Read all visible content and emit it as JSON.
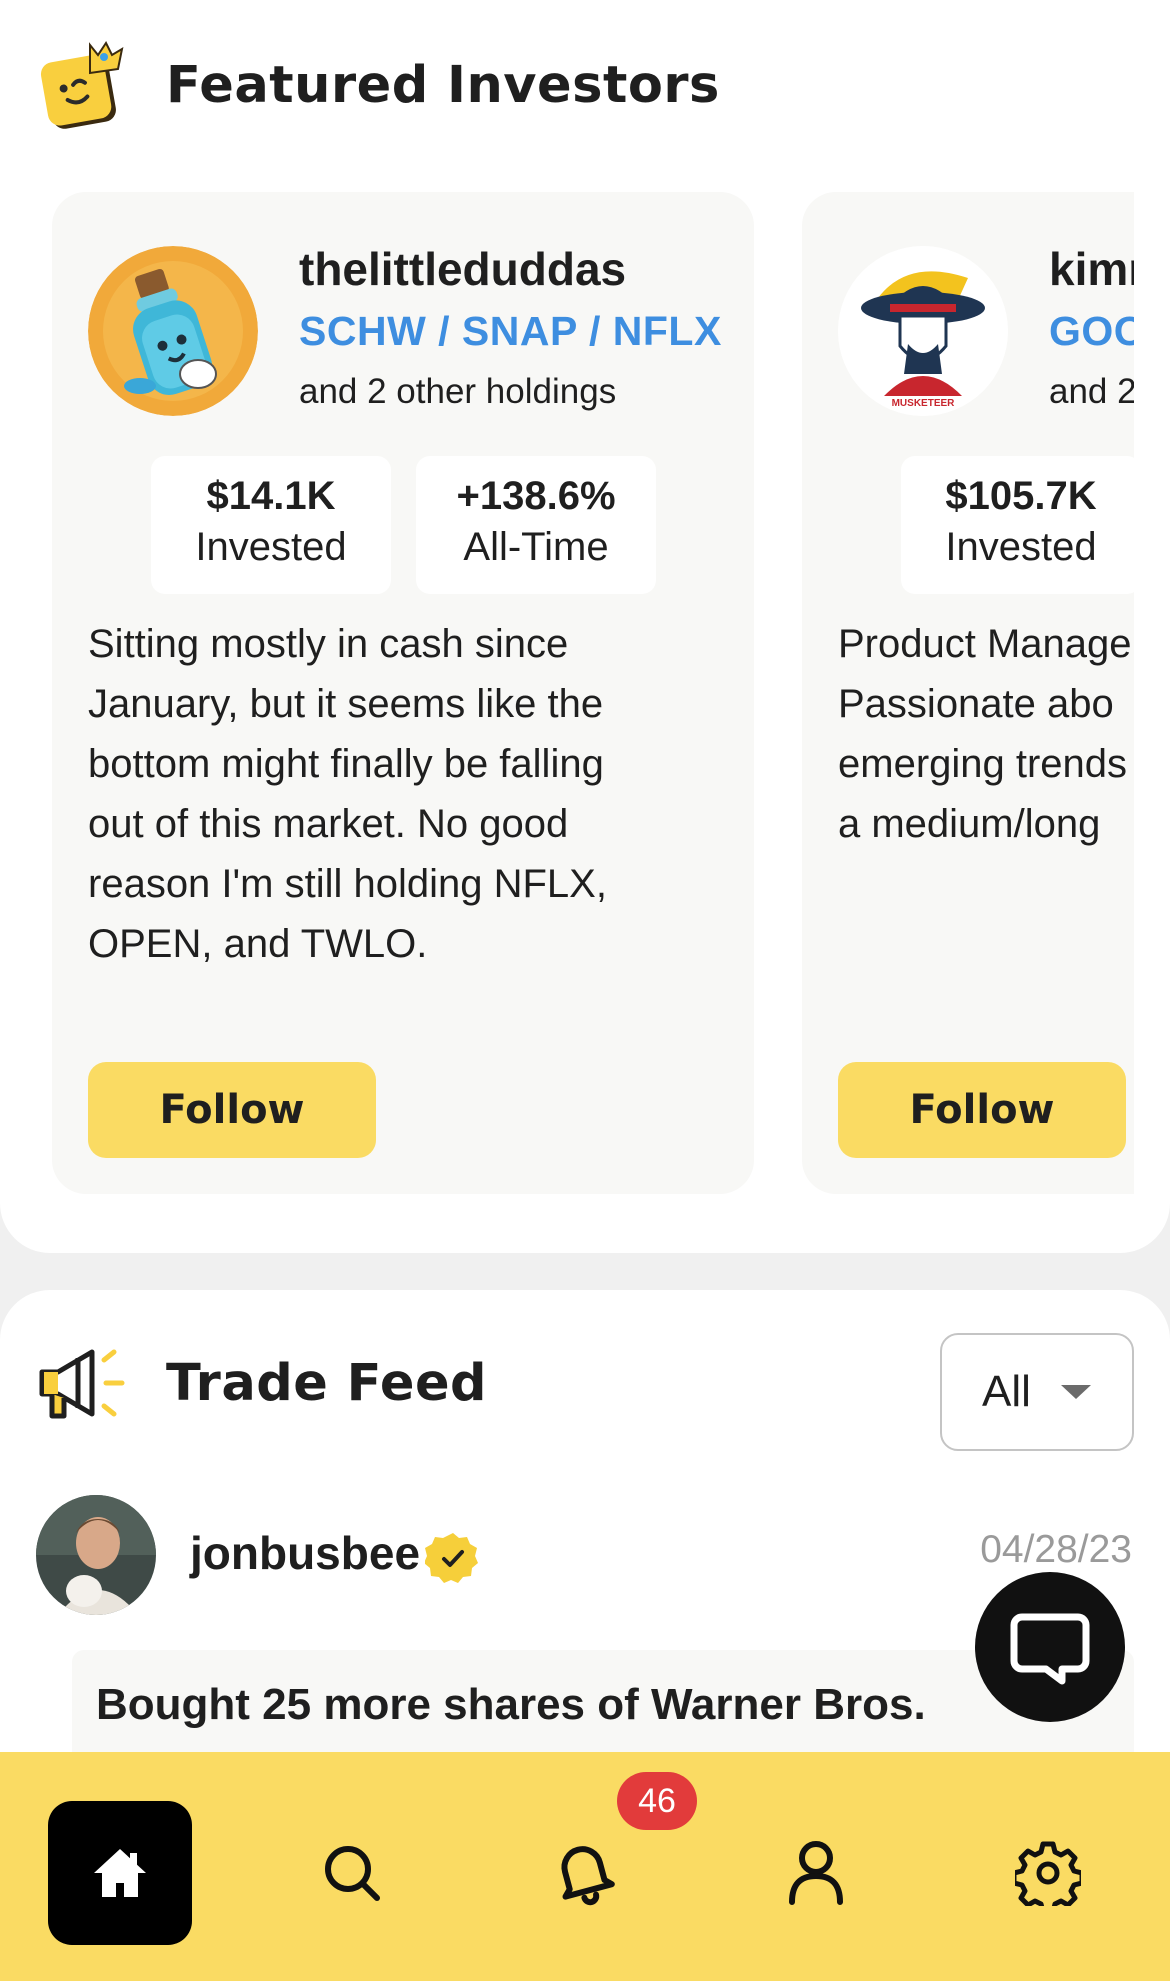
{
  "featured": {
    "title": "Featured Investors",
    "investors": [
      {
        "username": "thelittleduddas",
        "tickers": "SCHW / SNAP / NFLX",
        "other_holdings": "and 2 other holdings",
        "stats": [
          {
            "value": "$14.1K",
            "label": "Invested"
          },
          {
            "value": "+138.6%",
            "label": "All-Time"
          }
        ],
        "bio": "Sitting mostly in cash since\nJanuary, but it seems like the\nbottom might finally be falling\nout of this market. No good\nreason I'm still holding NFLX,\nOPEN, and TWLO.",
        "follow_label": "Follow"
      },
      {
        "username": "kimr",
        "tickers": "GOO",
        "other_holdings": "and 2",
        "avatar_text": "MUSKETEER",
        "stats": [
          {
            "value": "$105.7K",
            "label": "Invested"
          }
        ],
        "bio": "Product Manage\nPassionate abo\nemerging trends\na medium/long",
        "follow_label": "Follow"
      }
    ]
  },
  "feed": {
    "title": "Trade Feed",
    "filter": {
      "selected": "All"
    },
    "posts": [
      {
        "username": "jonbusbee",
        "verified": true,
        "date": "04/28/23",
        "text": "Bought 25 more shares of Warner Bros."
      }
    ]
  },
  "nav": {
    "items": [
      {
        "icon": "home-icon",
        "active": true
      },
      {
        "icon": "search-icon",
        "active": false
      },
      {
        "icon": "bell-icon",
        "active": false,
        "badge": "46"
      },
      {
        "icon": "user-icon",
        "active": false
      },
      {
        "icon": "gear-icon",
        "active": false
      }
    ]
  },
  "colors": {
    "accent": "#fadb63",
    "ticker": "#3e8ee0",
    "badge": "#e23b3b",
    "card_bg": "#f8f8f6"
  }
}
